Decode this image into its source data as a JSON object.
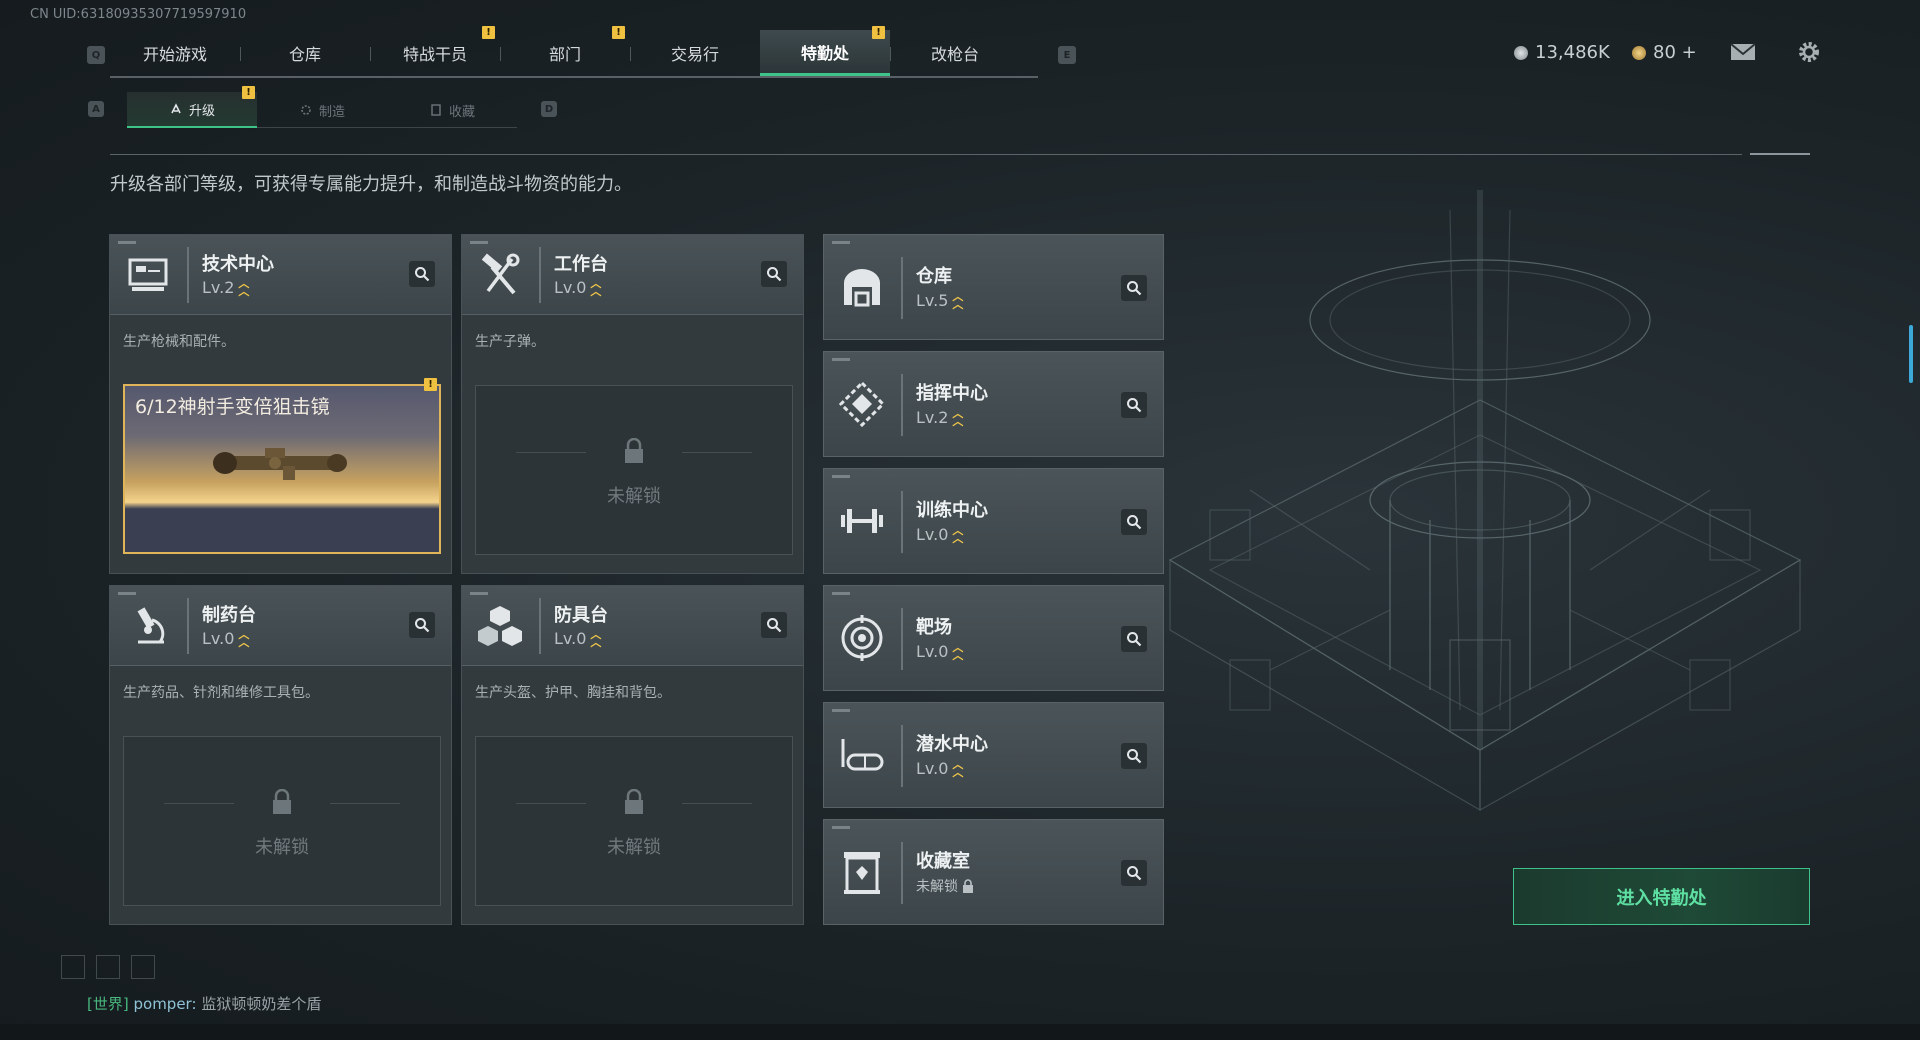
{
  "uid": "CN UID:63180935307719597910",
  "keys": {
    "left_tab": "Q",
    "right_tab": "E",
    "left_sub": "A",
    "right_sub": "D"
  },
  "nav": {
    "tabs": [
      {
        "label": "开始游戏",
        "alert": false
      },
      {
        "label": "仓库",
        "alert": false
      },
      {
        "label": "特战干员",
        "alert": true
      },
      {
        "label": "部门",
        "alert": true
      },
      {
        "label": "交易行",
        "alert": false
      },
      {
        "label": "特勤处",
        "alert": true,
        "active": true
      },
      {
        "label": "改枪台",
        "alert": false
      }
    ],
    "alert_glyph": "!"
  },
  "currency": {
    "primary": "13,486K",
    "secondary": "80 +"
  },
  "subnav": {
    "tabs": [
      {
        "label": "升级",
        "alert": true,
        "active": true
      },
      {
        "label": "制造"
      },
      {
        "label": "收藏"
      }
    ]
  },
  "description": "升级各部门等级，可获得专属能力提升，和制造战斗物资的能力。",
  "facilities": [
    {
      "title": "技术中心",
      "level": "Lv.2",
      "icon": "monitor-icon",
      "desc": "生产枪械和配件。",
      "production": {
        "item": "6/12神射手变倍狙击镜",
        "alert": true
      }
    },
    {
      "title": "工作台",
      "level": "Lv.0",
      "icon": "hammer-wrench-icon",
      "desc": "生产子弹。",
      "locked_text": "未解锁"
    },
    {
      "title": "制药台",
      "level": "Lv.0",
      "icon": "microscope-icon",
      "desc": "生产药品、针剂和维修工具包。",
      "locked_text": "未解锁"
    },
    {
      "title": "防具台",
      "level": "Lv.0",
      "icon": "armor-cubes-icon",
      "desc": "生产头盔、护甲、胸挂和背包。",
      "locked_text": "未解锁"
    }
  ],
  "departments": [
    {
      "title": "仓库",
      "level": "Lv.5",
      "icon": "warehouse-icon"
    },
    {
      "title": "指挥中心",
      "level": "Lv.2",
      "icon": "command-icon"
    },
    {
      "title": "训练中心",
      "level": "Lv.0",
      "icon": "dumbbell-icon"
    },
    {
      "title": "靶场",
      "level": "Lv.0",
      "icon": "target-icon"
    },
    {
      "title": "潜水中心",
      "level": "Lv.0",
      "icon": "goggles-icon"
    },
    {
      "title": "收藏室",
      "level": "未解锁",
      "icon": "collection-icon",
      "locked": true
    }
  ],
  "enter_button": "进入特勤处",
  "chat": {
    "channel": "[世界]",
    "name": "pomper:",
    "message": "监狱顿顿奶差个盾"
  },
  "colors": {
    "accent": "#3ec489",
    "alert": "#f0c040",
    "level_chevron": "#f0c64a"
  }
}
